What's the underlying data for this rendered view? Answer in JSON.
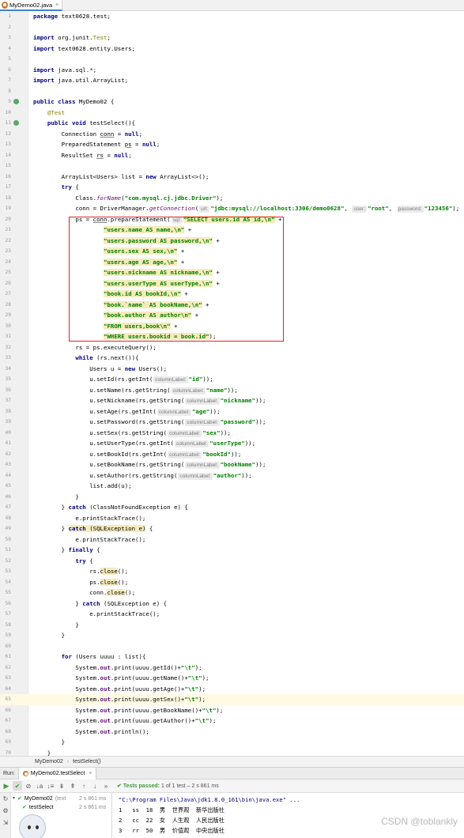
{
  "tab": {
    "label": "MyDemo02.java",
    "close": "×"
  },
  "gutter_icons": [
    {
      "line": "9",
      "kind": "run"
    },
    {
      "line": "11",
      "kind": "run"
    }
  ],
  "code": [
    {
      "n": "1",
      "t": [
        [
          "kw",
          "package "
        ],
        [
          "",
          "text0628.test;"
        ]
      ]
    },
    {
      "n": "2",
      "t": []
    },
    {
      "n": "3",
      "t": [
        [
          "kw",
          "import "
        ],
        [
          "",
          "org.junit."
        ],
        [
          "ann",
          "Test"
        ],
        [
          "",
          ";"
        ]
      ]
    },
    {
      "n": "4",
      "t": [
        [
          "kw",
          "import "
        ],
        [
          "",
          "text0628.entity.Users;"
        ]
      ]
    },
    {
      "n": "5",
      "t": []
    },
    {
      "n": "6",
      "t": [
        [
          "kw",
          "import "
        ],
        [
          "",
          "java.sql.*;"
        ]
      ]
    },
    {
      "n": "7",
      "t": [
        [
          "kw",
          "import "
        ],
        [
          "",
          "java.util.ArrayList;"
        ]
      ]
    },
    {
      "n": "8",
      "t": []
    },
    {
      "n": "9",
      "t": [
        [
          "kw",
          "public class "
        ],
        [
          "",
          "MyDemo02 {"
        ]
      ]
    },
    {
      "n": "10",
      "t": [
        [
          "",
          "    "
        ],
        [
          "ann",
          "@Test"
        ]
      ]
    },
    {
      "n": "11",
      "t": [
        [
          "",
          "    "
        ],
        [
          "kw",
          "public void "
        ],
        [
          "",
          "testSelect(){"
        ]
      ]
    },
    {
      "n": "12",
      "t": [
        [
          "",
          "        Connection "
        ],
        [
          "ul",
          "conn"
        ],
        [
          "",
          " = "
        ],
        [
          "kw",
          "null"
        ],
        [
          "",
          ";"
        ]
      ]
    },
    {
      "n": "13",
      "t": [
        [
          "",
          "        PreparedStatement "
        ],
        [
          "ul",
          "ps"
        ],
        [
          "",
          " = "
        ],
        [
          "kw",
          "null"
        ],
        [
          "",
          ";"
        ]
      ]
    },
    {
      "n": "14",
      "t": [
        [
          "",
          "        ResultSet "
        ],
        [
          "ul",
          "rs"
        ],
        [
          "",
          " = "
        ],
        [
          "kw",
          "null"
        ],
        [
          "",
          ";"
        ]
      ]
    },
    {
      "n": "15",
      "t": []
    },
    {
      "n": "16",
      "t": [
        [
          "",
          "        ArrayList<Users> list = "
        ],
        [
          "kw",
          "new "
        ],
        [
          "",
          "ArrayList<>();"
        ]
      ]
    },
    {
      "n": "17",
      "t": [
        [
          "",
          "        "
        ],
        [
          "kw",
          "try "
        ],
        [
          "",
          "{"
        ]
      ]
    },
    {
      "n": "18",
      "t": [
        [
          "",
          "            Class."
        ],
        [
          "st",
          "forName"
        ],
        [
          "",
          "("
        ],
        [
          "str",
          "\"com.mysql.cj.jdbc.Driver\""
        ],
        [
          "",
          ");"
        ]
      ]
    },
    {
      "n": "19",
      "t": [
        [
          "",
          "            conn = DriverManager."
        ],
        [
          "st",
          "getConnection"
        ],
        [
          "",
          "("
        ],
        [
          "hint",
          "url:"
        ],
        [
          "str",
          "\"jdbc:mysql://localhost:3306/demo0628\""
        ],
        [
          "",
          ", "
        ],
        [
          "hint",
          "user:"
        ],
        [
          "str",
          "\"root\""
        ],
        [
          "",
          ", "
        ],
        [
          "hint",
          "password:"
        ],
        [
          "str",
          "\"123456\""
        ],
        [
          "",
          ");"
        ]
      ]
    },
    {
      "n": "20",
      "t": [
        [
          "",
          "            ps = "
        ],
        [
          "ul",
          "conn"
        ],
        [
          "",
          ".prepareStatement("
        ],
        [
          "hint",
          "sql:"
        ],
        [
          "str hl",
          "\"SELECT users.id AS id,\\n\""
        ],
        [
          "",
          " +"
        ]
      ]
    },
    {
      "n": "21",
      "t": [
        [
          "",
          "                    "
        ],
        [
          "str hl",
          "\"users.name AS name,\\n\""
        ],
        [
          "",
          " +"
        ]
      ]
    },
    {
      "n": "22",
      "t": [
        [
          "",
          "                    "
        ],
        [
          "str hl",
          "\"users.password AS password,\\n\""
        ],
        [
          "",
          " +"
        ]
      ]
    },
    {
      "n": "23",
      "t": [
        [
          "",
          "                    "
        ],
        [
          "str hl",
          "\"users.sex AS sex,\\n\""
        ],
        [
          "",
          " +"
        ]
      ]
    },
    {
      "n": "24",
      "t": [
        [
          "",
          "                    "
        ],
        [
          "str hl",
          "\"users.age AS age,\\n\""
        ],
        [
          "",
          " +"
        ]
      ]
    },
    {
      "n": "25",
      "t": [
        [
          "",
          "                    "
        ],
        [
          "str hl",
          "\"users.nickname AS nickname,\\n\""
        ],
        [
          "",
          " +"
        ]
      ]
    },
    {
      "n": "26",
      "t": [
        [
          "",
          "                    "
        ],
        [
          "str hl",
          "\"users.userType AS userType,\\n\""
        ],
        [
          "",
          " +"
        ]
      ]
    },
    {
      "n": "27",
      "t": [
        [
          "",
          "                    "
        ],
        [
          "str hl",
          "\"book.id AS bookId,\\n\""
        ],
        [
          "",
          " +"
        ]
      ]
    },
    {
      "n": "28",
      "t": [
        [
          "",
          "                    "
        ],
        [
          "str hl",
          "\"book.`name` AS bookName,\\n\""
        ],
        [
          "",
          " +"
        ]
      ]
    },
    {
      "n": "29",
      "t": [
        [
          "",
          "                    "
        ],
        [
          "str hl",
          "\"book.author AS author\\n\""
        ],
        [
          "",
          " +"
        ]
      ]
    },
    {
      "n": "30",
      "t": [
        [
          "",
          "                    "
        ],
        [
          "str hl",
          "\"FROM users,book\\n\""
        ],
        [
          "",
          " +"
        ]
      ]
    },
    {
      "n": "31",
      "t": [
        [
          "",
          "                    "
        ],
        [
          "str hl",
          "\"WHERE users.bookid = book.id\""
        ],
        [
          "",
          ");"
        ]
      ]
    },
    {
      "n": "32",
      "t": [
        [
          "",
          "            rs = ps.executeQuery();"
        ]
      ]
    },
    {
      "n": "33",
      "t": [
        [
          "",
          "            "
        ],
        [
          "kw",
          "while "
        ],
        [
          "",
          "(rs.next()){"
        ]
      ]
    },
    {
      "n": "34",
      "t": [
        [
          "",
          "                Users u = "
        ],
        [
          "kw",
          "new "
        ],
        [
          "",
          "Users();"
        ]
      ]
    },
    {
      "n": "35",
      "t": [
        [
          "",
          "                u.setId(rs.getInt("
        ],
        [
          "hint",
          "columnLabel:"
        ],
        [
          "str",
          "\"id\""
        ],
        [
          "",
          "));"
        ]
      ]
    },
    {
      "n": "36",
      "t": [
        [
          "",
          "                u.setName(rs.getString("
        ],
        [
          "hint",
          "columnLabel:"
        ],
        [
          "str",
          "\"name\""
        ],
        [
          "",
          "));"
        ]
      ]
    },
    {
      "n": "37",
      "t": [
        [
          "",
          "                u.setNickname(rs.getString("
        ],
        [
          "hint",
          "columnLabel:"
        ],
        [
          "str",
          "\"nickname\""
        ],
        [
          "",
          "));"
        ]
      ]
    },
    {
      "n": "38",
      "t": [
        [
          "",
          "                u.setAge(rs.getInt("
        ],
        [
          "hint",
          "columnLabel:"
        ],
        [
          "str",
          "\"age\""
        ],
        [
          "",
          "));"
        ]
      ]
    },
    {
      "n": "39",
      "t": [
        [
          "",
          "                u.setPassword(rs.getString("
        ],
        [
          "hint",
          "columnLabel:"
        ],
        [
          "str",
          "\"password\""
        ],
        [
          "",
          "));"
        ]
      ]
    },
    {
      "n": "40",
      "t": [
        [
          "",
          "                u.setSex(rs.getString("
        ],
        [
          "hint",
          "columnLabel:"
        ],
        [
          "str",
          "\"sex\""
        ],
        [
          "",
          "));"
        ]
      ]
    },
    {
      "n": "41",
      "t": [
        [
          "",
          "                u.setUserType(rs.getInt("
        ],
        [
          "hint",
          "columnLabel:"
        ],
        [
          "str",
          "\"userType\""
        ],
        [
          "",
          "));"
        ]
      ]
    },
    {
      "n": "42",
      "t": [
        [
          "",
          "                u.setBookId(rs.getInt("
        ],
        [
          "hint",
          "columnLabel:"
        ],
        [
          "str",
          "\"bookId\""
        ],
        [
          "",
          "));"
        ]
      ]
    },
    {
      "n": "43",
      "t": [
        [
          "",
          "                u.setBookName(rs.getString("
        ],
        [
          "hint",
          "columnLabel:"
        ],
        [
          "str",
          "\"bookName\""
        ],
        [
          "",
          "));"
        ]
      ]
    },
    {
      "n": "44",
      "t": [
        [
          "",
          "                u.setAuthor(rs.getString("
        ],
        [
          "hint",
          "columnLabel:"
        ],
        [
          "str",
          "\"author\""
        ],
        [
          "",
          "));"
        ]
      ]
    },
    {
      "n": "45",
      "t": [
        [
          "",
          "                list.add(u);"
        ]
      ]
    },
    {
      "n": "46",
      "t": [
        [
          "",
          "            }"
        ]
      ]
    },
    {
      "n": "47",
      "t": [
        [
          "",
          "        } "
        ],
        [
          "kw",
          "catch "
        ],
        [
          "",
          "(ClassNotFoundException e) {"
        ]
      ]
    },
    {
      "n": "48",
      "t": [
        [
          "",
          "            e.printStackTrace();"
        ]
      ]
    },
    {
      "n": "49",
      "t": [
        [
          "",
          "        } "
        ],
        [
          "kw hl",
          "catch "
        ],
        [
          "hl",
          "(SQLException e)"
        ],
        [
          "",
          " {"
        ]
      ]
    },
    {
      "n": "50",
      "t": [
        [
          "",
          "            e.printStackTrace();"
        ]
      ]
    },
    {
      "n": "51",
      "t": [
        [
          "",
          "        } "
        ],
        [
          "kw",
          "finally "
        ],
        [
          "",
          "{"
        ]
      ]
    },
    {
      "n": "52",
      "t": [
        [
          "",
          "            "
        ],
        [
          "kw",
          "try "
        ],
        [
          "",
          "{"
        ]
      ]
    },
    {
      "n": "53",
      "t": [
        [
          "",
          "                rs."
        ],
        [
          "hl",
          "close"
        ],
        [
          "",
          "();"
        ]
      ]
    },
    {
      "n": "54",
      "t": [
        [
          "",
          "                ps."
        ],
        [
          "hl",
          "close"
        ],
        [
          "",
          "();"
        ]
      ]
    },
    {
      "n": "55",
      "t": [
        [
          "",
          "                conn."
        ],
        [
          "hl",
          "close"
        ],
        [
          "",
          "();"
        ]
      ]
    },
    {
      "n": "56",
      "t": [
        [
          "",
          "            } "
        ],
        [
          "kw",
          "catch "
        ],
        [
          "",
          "(SQLException e) {"
        ]
      ]
    },
    {
      "n": "57",
      "t": [
        [
          "",
          "                e.printStackTrace();"
        ]
      ]
    },
    {
      "n": "58",
      "t": [
        [
          "",
          "            }"
        ]
      ]
    },
    {
      "n": "59",
      "t": [
        [
          "",
          "        }"
        ]
      ]
    },
    {
      "n": "60",
      "t": []
    },
    {
      "n": "61",
      "t": [
        [
          "",
          "        "
        ],
        [
          "kw",
          "for "
        ],
        [
          "",
          "(Users uuuu : list){"
        ]
      ]
    },
    {
      "n": "62",
      "t": [
        [
          "",
          "            System."
        ],
        [
          "fld",
          "out"
        ],
        [
          "",
          ".print(uuuu.getId()+"
        ],
        [
          "str",
          "\"\\t\""
        ],
        [
          "",
          ");"
        ]
      ]
    },
    {
      "n": "63",
      "t": [
        [
          "",
          "            System."
        ],
        [
          "fld",
          "out"
        ],
        [
          "",
          ".print(uuuu.getName()+"
        ],
        [
          "str",
          "\"\\t\""
        ],
        [
          "",
          ");"
        ]
      ]
    },
    {
      "n": "64",
      "t": [
        [
          "",
          "            System."
        ],
        [
          "fld",
          "out"
        ],
        [
          "",
          ".print(uuuu.getAge()+"
        ],
        [
          "str",
          "\"\\t\""
        ],
        [
          "",
          ");"
        ]
      ]
    },
    {
      "n": "65",
      "t": [
        [
          "",
          "            System."
        ],
        [
          "fld",
          "out"
        ],
        [
          "",
          ".print(uuuu.getSex()+"
        ],
        [
          "str",
          "\"\\t\""
        ],
        [
          "",
          ");"
        ]
      ],
      "current": true
    },
    {
      "n": "66",
      "t": [
        [
          "",
          "            System."
        ],
        [
          "fld",
          "out"
        ],
        [
          "",
          ".print(uuuu.getBookName()+"
        ],
        [
          "str",
          "\"\\t\""
        ],
        [
          "",
          ");"
        ]
      ]
    },
    {
      "n": "67",
      "t": [
        [
          "",
          "            System."
        ],
        [
          "fld",
          "out"
        ],
        [
          "",
          ".print(uuuu.getAuthor()+"
        ],
        [
          "str",
          "\"\\t\""
        ],
        [
          "",
          ");"
        ]
      ]
    },
    {
      "n": "68",
      "t": [
        [
          "",
          "            System."
        ],
        [
          "fld",
          "out"
        ],
        [
          "",
          ".println();"
        ]
      ]
    },
    {
      "n": "69",
      "t": [
        [
          "",
          "        }"
        ]
      ]
    },
    {
      "n": "70",
      "t": [
        [
          "",
          "    }"
        ]
      ]
    }
  ],
  "breadcrumb": {
    "class": "MyDemo02",
    "method": "testSelect()"
  },
  "run": {
    "label": "Run:",
    "tab": "MyDemo02.testSelect",
    "close": "×",
    "passed": "Tests passed:",
    "passed_detail": "1 of 1 test – 2 s 861 ms"
  },
  "tree": [
    {
      "label": "MyDemo02",
      "sub": "(text",
      "time": "2 s 861 ms"
    },
    {
      "label": "testSelect",
      "sub": "",
      "time": "2 s 861 ms"
    }
  ],
  "console": [
    "\"C:\\Program Files\\Java\\jdk1.8.0_161\\bin\\java.exe\" ...",
    "1   ss  18  男  世界观  新华出版社",
    "2   cc  22  女  人生观  人民出版社",
    "3   rr  50  男  价值观  中央出版社"
  ],
  "watermark": "CSDN @toblankly"
}
